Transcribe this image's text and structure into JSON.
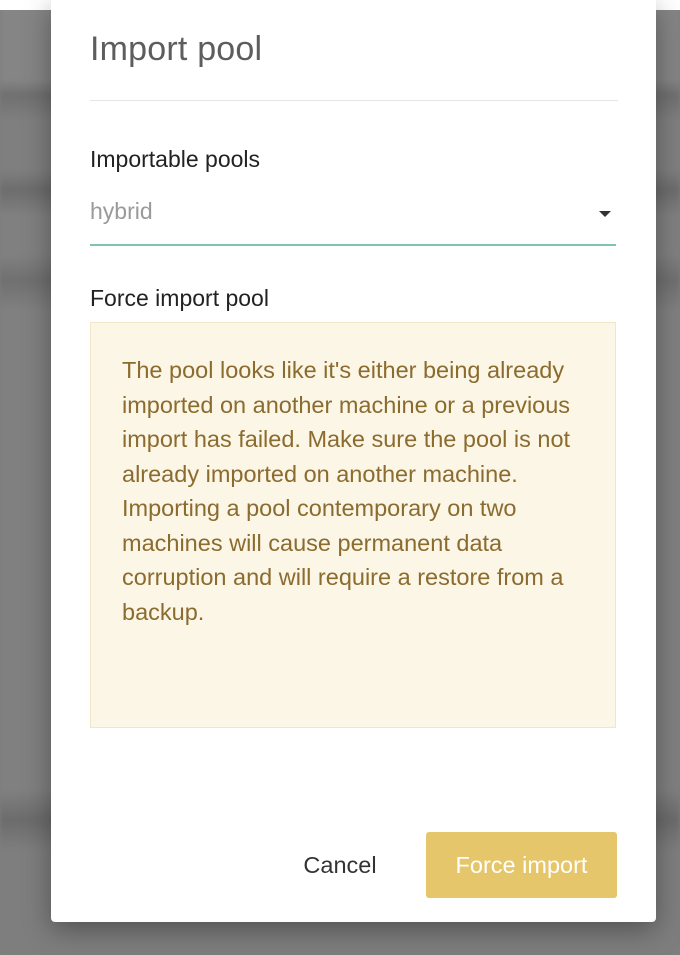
{
  "dialog": {
    "title": "Import pool"
  },
  "importable_pools": {
    "label": "Importable pools",
    "selected_value": "hybrid"
  },
  "force_import": {
    "label": "Force import pool",
    "warning": "The pool looks like it's either being already imported on another machine or a previous import has failed. Make sure the pool is not already imported on another machine. Importing a pool contemporary on two machines will cause permanent data corruption and will require a restore from a backup."
  },
  "actions": {
    "cancel_label": "Cancel",
    "force_import_label": "Force import"
  },
  "colors": {
    "select_underline": "#7dc4b5",
    "warning_background": "#fbf6e6",
    "warning_text": "#8b6b2e",
    "primary_button": "#e5c66a"
  }
}
